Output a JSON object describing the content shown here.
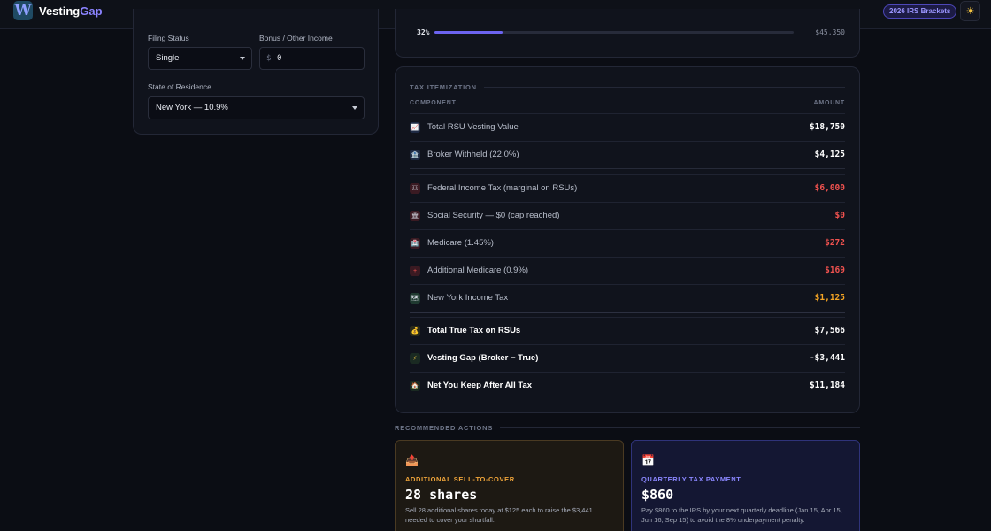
{
  "header": {
    "brand_part1": "Vesting",
    "brand_part2": "Gap",
    "logo_letter": "W",
    "badge": "2026 IRS Brackets",
    "theme_icon": "sun-icon"
  },
  "inputs": {
    "filing_status_label": "Filing Status",
    "filing_status_value": "Single",
    "bonus_label": "Bonus / Other Income",
    "bonus_currency": "$",
    "bonus_value": "0",
    "state_label": "State of Residence",
    "state_value": "New York — 10.9%"
  },
  "bracket": {
    "rate": "32%",
    "fill_percent": 19,
    "amount": "$45,350",
    "fill_color": "#6c63f0"
  },
  "itemization": {
    "title": "TAX ITEMIZATION",
    "col_component": "COMPONENT",
    "col_amount": "AMOUNT",
    "rows": [
      {
        "icon": "chart-icon",
        "label": "Total RSU Vesting Value",
        "value": "$18,750",
        "color": "#ffffff"
      },
      {
        "icon": "bank-icon",
        "label": "Broker Withheld (22.0%)",
        "value": "$4,125",
        "color": "#ffffff"
      },
      {
        "icon": "flag-icon",
        "label": "Federal Income Tax (marginal on RSUs)",
        "value": "$6,000",
        "color": "#f0524f"
      },
      {
        "icon": "building-icon",
        "label": "Social Security — $0 (cap reached)",
        "value": "$0",
        "color": "#f0524f"
      },
      {
        "icon": "hospital-icon",
        "label": "Medicare (1.45%)",
        "value": "$272",
        "color": "#f0524f"
      },
      {
        "icon": "plus-icon",
        "label": "Additional Medicare (0.9%)",
        "value": "$169",
        "color": "#f0524f"
      },
      {
        "icon": "map-icon",
        "label": "New York Income Tax",
        "value": "$1,125",
        "color": "#f5a524"
      }
    ],
    "totals": [
      {
        "icon": "money-bag-icon",
        "label": "Total True Tax on RSUs",
        "value": "$7,566",
        "color": "#ffffff"
      },
      {
        "icon": "lightning-icon",
        "label": "Vesting Gap (Broker − True)",
        "value": "-$3,441",
        "color": "#ffffff"
      },
      {
        "icon": "house-icon",
        "label": "Net You Keep After All Tax",
        "value": "$11,184",
        "color": "#ffffff"
      }
    ]
  },
  "recommended": {
    "title": "RECOMMENDED ACTIONS",
    "cards": [
      {
        "icon": "outbox-tray-icon",
        "kicker": "ADDITIONAL SELL-TO-COVER",
        "big": "28 shares",
        "desc": "Sell 28 additional shares today at $125 each to raise the $3,441 needed to cover your shortfall."
      },
      {
        "icon": "calendar-icon",
        "kicker": "QUARTERLY TAX PAYMENT",
        "big": "$860",
        "desc": "Pay $860 to the IRS by your next quarterly deadline (Jan 15, Apr 15, Jun 16, Sep 15) to avoid the 8% underpayment penalty."
      }
    ]
  }
}
